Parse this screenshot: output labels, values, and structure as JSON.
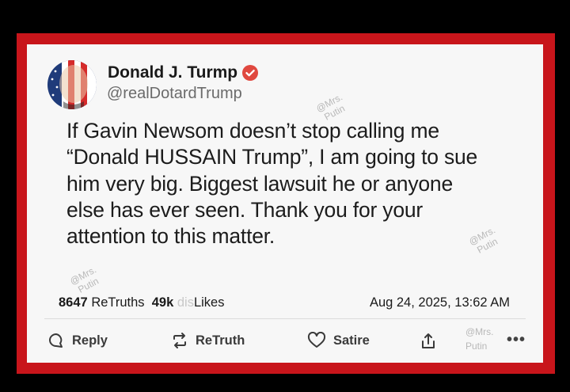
{
  "post": {
    "display_name": "Donald J. Turmp",
    "handle": "@realDotardTrump",
    "verified": true,
    "body_lines": [
      "If Gavin Newsom doesn’t stop calling me",
      "“Donald HUSSAIN Trump”, I am going to sue",
      "him very big.  Biggest lawsuit he or anyone",
      "else has ever seen.  Thank you for your",
      "attention to this matter."
    ],
    "stats": {
      "retruths_count": "8647",
      "retruths_label": "ReTruths",
      "likes_count": "49k",
      "likes_prefix": "dis",
      "likes_label": "Likes"
    },
    "timestamp": "Aug 24, 2025, 13:62 AM"
  },
  "actions": {
    "reply": "Reply",
    "retruth": "ReTruth",
    "satire": "Satire",
    "more": "•••"
  },
  "watermark": {
    "line1": "@Mrs.",
    "line2": "Putin"
  },
  "colors": {
    "frame_border": "#c8151b",
    "verified_badge": "#e0483f",
    "card_background": "#f7f7f7"
  },
  "icons": [
    "reply-icon",
    "retruth-icon",
    "heart-icon",
    "share-icon",
    "more-icon",
    "verified-icon"
  ]
}
